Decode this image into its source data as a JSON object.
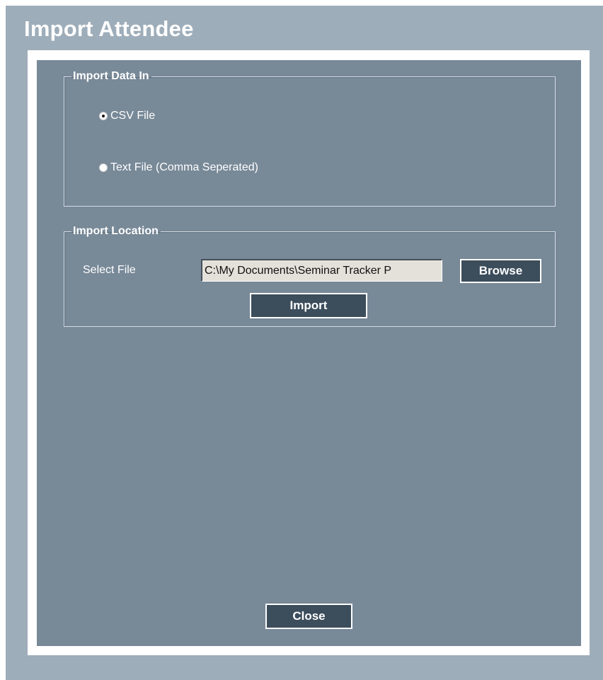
{
  "window": {
    "title": "Import Attendee"
  },
  "import_data_in": {
    "legend": "Import Data In",
    "options": [
      {
        "label": "CSV File",
        "checked": true
      },
      {
        "label": "Text File (Comma Seperated)",
        "checked": false
      }
    ]
  },
  "import_location": {
    "legend": "Import Location",
    "select_file_label": "Select File",
    "file_path_value": "C:\\My Documents\\Seminar Tracker P",
    "browse_label": "Browse",
    "import_label": "Import"
  },
  "footer": {
    "close_label": "Close"
  },
  "colors": {
    "window_bg": "#9eadba",
    "panel_bg": "#788998",
    "button_bg": "#3c4d5c",
    "input_bg": "#e4e1da"
  }
}
